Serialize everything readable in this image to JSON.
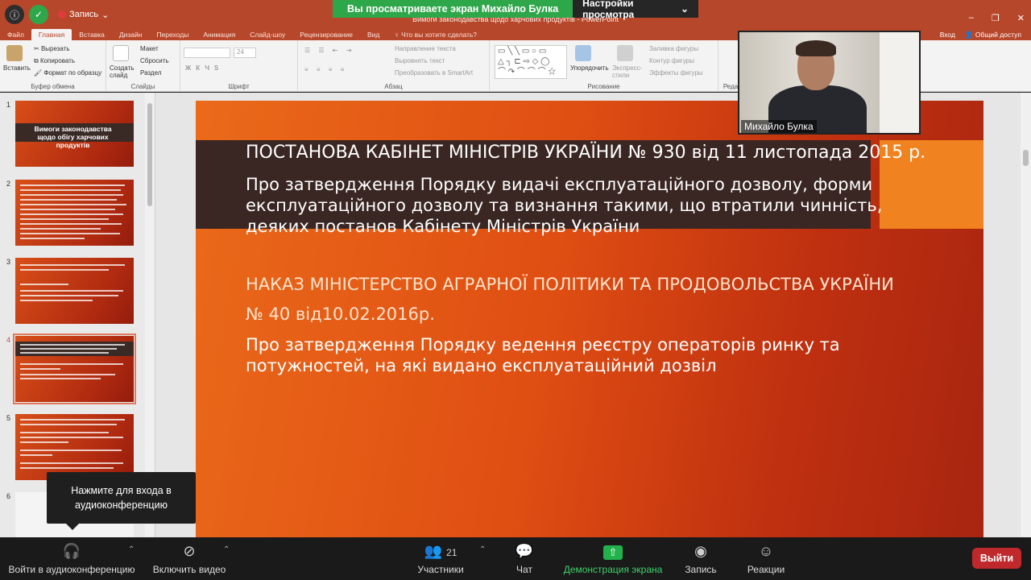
{
  "zoom": {
    "banner_text": "Вы просматриваете экран Михайло Булка",
    "view_settings": "Настройки просмотра",
    "recording_label": "Запись",
    "tooltip": "Нажмите для входа в аудиоконференцию",
    "participant_name": "Михайло Булка",
    "toolbar": {
      "audio": "Войти в аудиоконференцию",
      "video": "Включить видео",
      "participants": "Участники",
      "participants_count": "21",
      "chat": "Чат",
      "share": "Демонстрация экрана",
      "record": "Запись",
      "reactions": "Реакции",
      "leave": "Выйти"
    }
  },
  "ppt": {
    "document_title": "Вимоги законодавства щодо харчових продуктів - PowerPoint",
    "tabs": [
      "Файл",
      "Главная",
      "Вставка",
      "Дизайн",
      "Переходы",
      "Анимация",
      "Слайд-шоу",
      "Рецензирование",
      "Вид",
      "♀ Что вы хотите сделать?"
    ],
    "active_tab": "Главная",
    "sign_in": "Вход",
    "share": "Общий доступ",
    "ribbon": {
      "paste": "Вставить",
      "cut": "Вырезать",
      "copy": "Копировать",
      "format_painter": "Формат по образцу",
      "clipboard": "Буфер обмена",
      "new_slide": "Создать слайд",
      "layout": "Макет",
      "reset": "Сбросить",
      "section": "Раздел",
      "slides": "Слайды",
      "font_size": "24",
      "font": "Шрифт",
      "text_direction": "Направление текста",
      "align_text": "Выровнять текст",
      "convert_smartart": "Преобразовать в SmartArt",
      "paragraph": "Абзац",
      "arrange": "Упорядочить",
      "quick_styles": "Экспресс-стили",
      "shape_fill": "Заливка фигуры",
      "shape_outline": "Контур фигуры",
      "shape_effects": "Эффекты фигуры",
      "drawing": "Рисование",
      "editing": "Реда"
    },
    "thumbnails": [
      {
        "num": "1",
        "title": "Вимоги законодавства щодо обігу харчових продуктів"
      },
      {
        "num": "2"
      },
      {
        "num": "3"
      },
      {
        "num": "4"
      },
      {
        "num": "5"
      },
      {
        "num": "6"
      }
    ],
    "slide": {
      "heading1": "ПОСТАНОВА КАБІНЕТ МІНІСТРІВ УКРАЇНИ № 930 від 11 листопада 2015 р.",
      "body1_line1": "Про затвердження Порядку видачі експлуатаційного дозволу, форми",
      "body1_line2": "експлуатаційного дозволу та визнання такими, що втратили чинність,",
      "body1_line3": "деяких постанов Кабінету Міністрів України",
      "heading2": "НАКАЗ МІНІСТЕРСТВО АГРАРНОЇ ПОЛІТИКИ ТА ПРОДОВОЛЬСТВА УКРАЇНИ",
      "heading3": "№ 40 від10.02.2016р.",
      "body2_line1": "Про затвердження Порядку ведення реєстру операторів ринку та",
      "body2_line2": "потужностей, на які видано експлуатаційний дозвіл"
    }
  }
}
